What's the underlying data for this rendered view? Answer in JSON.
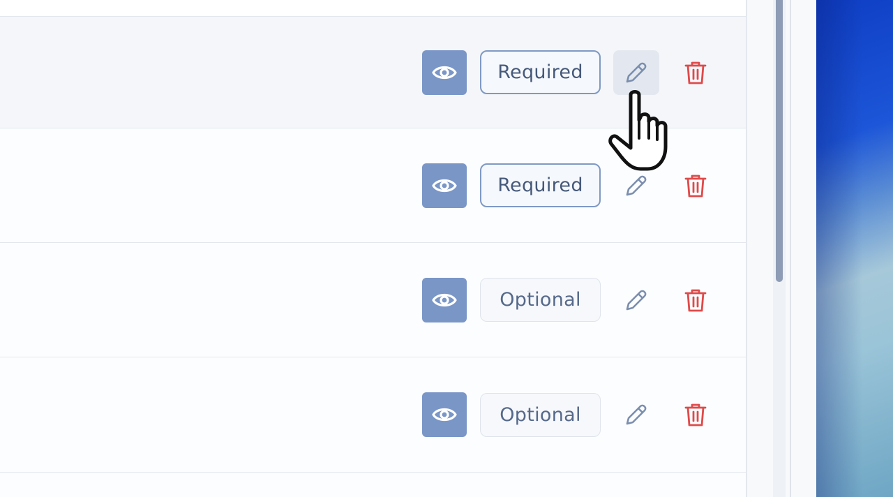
{
  "rows": [
    {
      "state": "hovered",
      "badge_label": "Required",
      "badge_style": "required",
      "edit_hover": true
    },
    {
      "state": "normal",
      "badge_label": "Required",
      "badge_style": "required",
      "edit_hover": false
    },
    {
      "state": "normal",
      "badge_label": "Optional",
      "badge_style": "optional",
      "edit_hover": false
    },
    {
      "state": "normal",
      "badge_label": "Optional",
      "badge_style": "optional",
      "edit_hover": false
    }
  ],
  "icons": {
    "view": "eye-icon",
    "edit": "pencil-icon",
    "delete": "trash-icon",
    "cursor": "hand-pointer-icon"
  },
  "colors": {
    "view_button": "#7a96c7",
    "required_border": "#7f99c4",
    "optional_border": "#dfe4ec",
    "edit_icon": "#7b8eae",
    "delete_icon": "#e04a4a",
    "row_hover": "#f4f6fa"
  }
}
